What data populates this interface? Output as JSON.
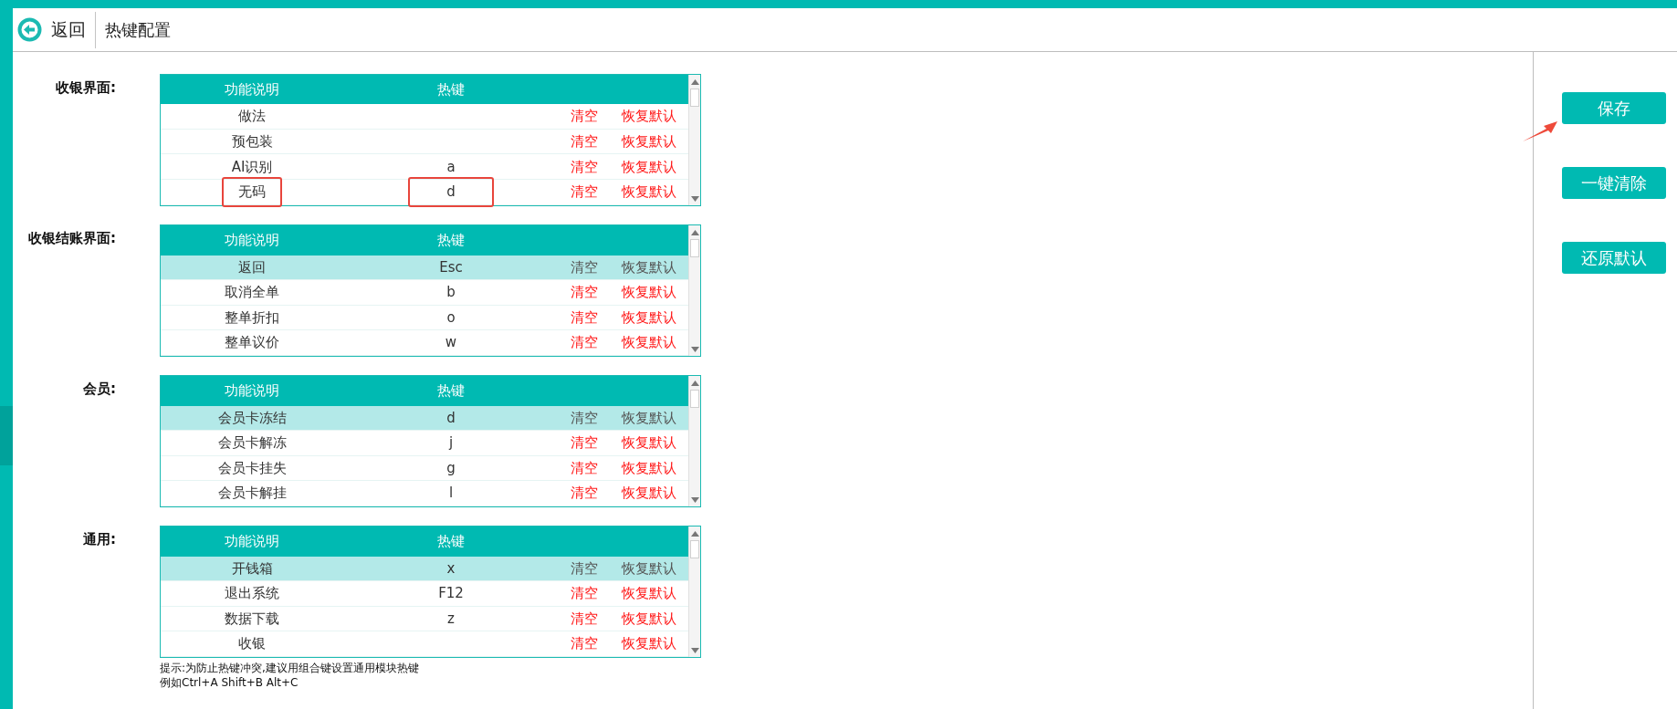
{
  "header": {
    "back": "返回",
    "title": "热键配置"
  },
  "sections": [
    {
      "label": "收银界面:",
      "columns": [
        "功能说明",
        "热键"
      ],
      "rows": [
        {
          "name": "做法",
          "key": "",
          "clear": "清空",
          "reset": "恢复默认",
          "selected": false,
          "marked": false
        },
        {
          "name": "预包装",
          "key": "",
          "clear": "清空",
          "reset": "恢复默认",
          "selected": false,
          "marked": false
        },
        {
          "name": "AI识别",
          "key": "a",
          "clear": "清空",
          "reset": "恢复默认",
          "selected": false,
          "marked": false
        },
        {
          "name": "无码",
          "key": "d",
          "clear": "清空",
          "reset": "恢复默认",
          "selected": false,
          "marked": true
        }
      ]
    },
    {
      "label": "收银结账界面:",
      "columns": [
        "功能说明",
        "热键"
      ],
      "rows": [
        {
          "name": "返回",
          "key": "Esc",
          "clear": "清空",
          "reset": "恢复默认",
          "selected": true,
          "marked": false
        },
        {
          "name": "取消全单",
          "key": "b",
          "clear": "清空",
          "reset": "恢复默认",
          "selected": false,
          "marked": false
        },
        {
          "name": "整单折扣",
          "key": "o",
          "clear": "清空",
          "reset": "恢复默认",
          "selected": false,
          "marked": false
        },
        {
          "name": "整单议价",
          "key": "w",
          "clear": "清空",
          "reset": "恢复默认",
          "selected": false,
          "marked": false
        }
      ]
    },
    {
      "label": "会员:",
      "columns": [
        "功能说明",
        "热键"
      ],
      "rows": [
        {
          "name": "会员卡冻结",
          "key": "d",
          "clear": "清空",
          "reset": "恢复默认",
          "selected": true,
          "marked": false
        },
        {
          "name": "会员卡解冻",
          "key": "j",
          "clear": "清空",
          "reset": "恢复默认",
          "selected": false,
          "marked": false
        },
        {
          "name": "会员卡挂失",
          "key": "g",
          "clear": "清空",
          "reset": "恢复默认",
          "selected": false,
          "marked": false
        },
        {
          "name": "会员卡解挂",
          "key": "l",
          "clear": "清空",
          "reset": "恢复默认",
          "selected": false,
          "marked": false
        }
      ]
    },
    {
      "label": "通用:",
      "columns": [
        "功能说明",
        "热键"
      ],
      "rows": [
        {
          "name": "开钱箱",
          "key": "x",
          "clear": "清空",
          "reset": "恢复默认",
          "selected": true,
          "marked": false
        },
        {
          "name": "退出系统",
          "key": "F12",
          "clear": "清空",
          "reset": "恢复默认",
          "selected": false,
          "marked": false
        },
        {
          "name": "数据下载",
          "key": "z",
          "clear": "清空",
          "reset": "恢复默认",
          "selected": false,
          "marked": false
        },
        {
          "name": "收银",
          "key": "",
          "clear": "清空",
          "reset": "恢复默认",
          "selected": false,
          "marked": false
        }
      ]
    }
  ],
  "hint": [
    "提示:为防止热键冲突,建议用组合键设置通用模块热键",
    "例如Ctrl+A Shift+B Alt+C"
  ],
  "buttons": [
    {
      "label": "保存",
      "pointed": true
    },
    {
      "label": "一键清除",
      "pointed": false
    },
    {
      "label": "还原默认",
      "pointed": false
    }
  ]
}
